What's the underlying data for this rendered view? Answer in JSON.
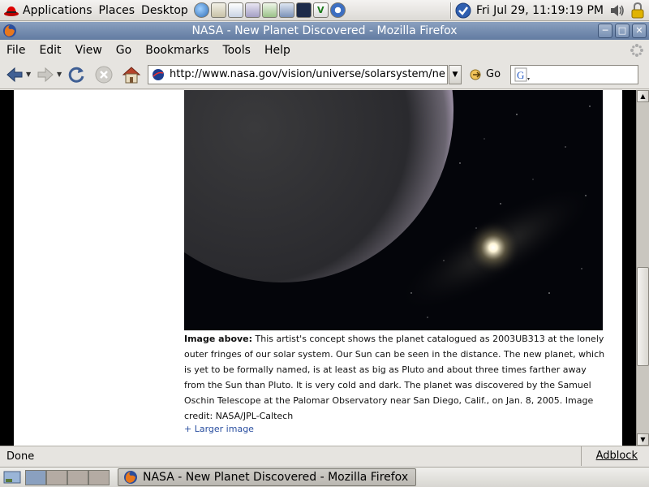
{
  "top_panel": {
    "menus": [
      "Applications",
      "Places",
      "Desktop"
    ],
    "clock": "Fri Jul 29, 11:19:19 PM"
  },
  "window": {
    "title": "NASA - New Planet Discovered - Mozilla Firefox"
  },
  "menubar": {
    "items": [
      "File",
      "Edit",
      "View",
      "Go",
      "Bookmarks",
      "Tools",
      "Help"
    ]
  },
  "navbar": {
    "url": "http://www.nasa.gov/vision/universe/solarsystem/newplan",
    "go_label": "Go",
    "search_value": ""
  },
  "page": {
    "caption_lead": "Image above:",
    "caption_body": " This artist's concept shows the planet catalogued as 2003UB313 at the lonely outer fringes of our solar system. Our Sun can be seen in the distance. The new planet, which is yet to be formally named, is at least as big as Pluto and about three times farther away from the Sun than Pluto. It is very cold and dark. The planet was discovered by the Samuel Oschin Telescope at the Palomar Observatory near San Diego, Calif., on Jan. 8, 2005. Image credit: NASA/JPL-Caltech",
    "larger_image_link": "+ Larger image"
  },
  "statusbar": {
    "status": "Done",
    "adblock": "Adblock"
  },
  "bottom_panel": {
    "task_title": "NASA - New Planet Discovered - Mozilla Firefox"
  },
  "colors": {
    "titlebar": "#6f87ab",
    "link": "#2a4fa0"
  }
}
